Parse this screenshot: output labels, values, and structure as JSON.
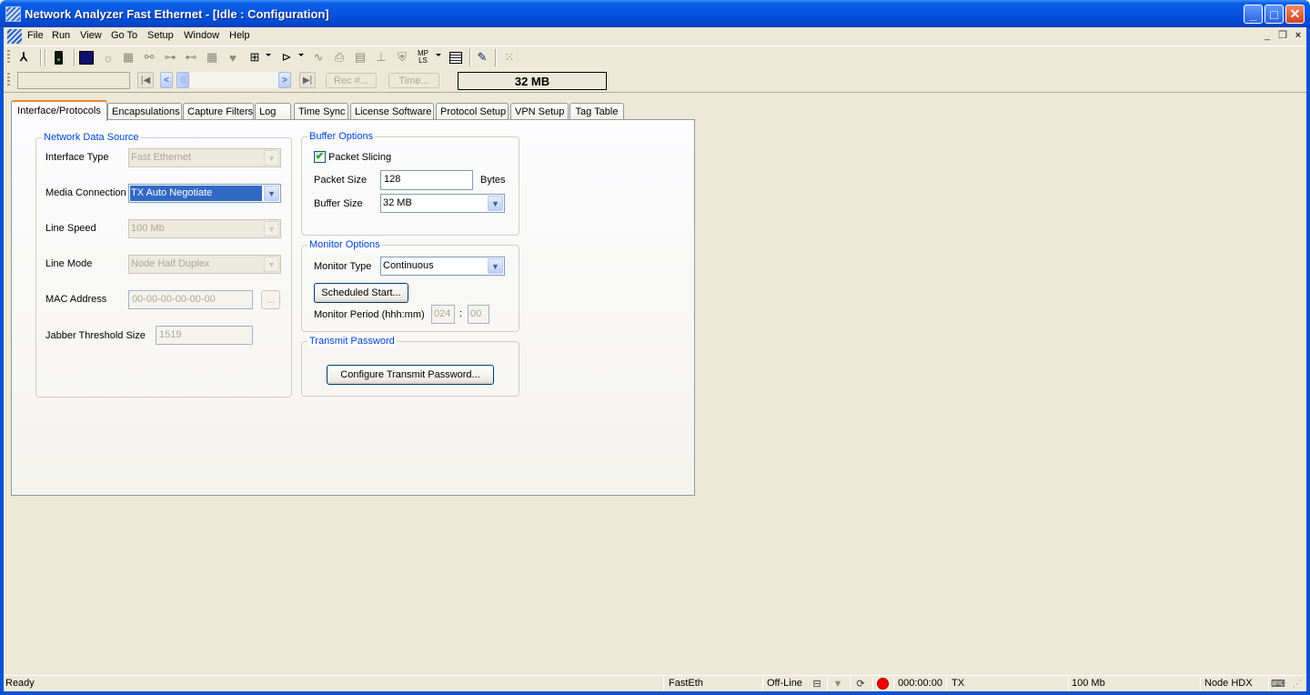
{
  "window": {
    "title": "Network Analyzer Fast Ethernet - [Idle : Configuration]",
    "controls": {
      "minimize": "_",
      "maximize": "□",
      "close": "✕"
    },
    "mdi_controls": {
      "minimize": "_",
      "restore": "❐",
      "close": "×"
    }
  },
  "menu": {
    "items": [
      "File",
      "Run",
      "View",
      "Go To",
      "Setup",
      "Window",
      "Help"
    ]
  },
  "toolbar": {
    "icons": [
      {
        "name": "run-icon",
        "glyph": "🏃"
      },
      {
        "name": "traffic-light-icon",
        "glyph": "▮"
      },
      {
        "name": "monitor-icon",
        "glyph": "◙"
      },
      {
        "name": "light-bulb-icon",
        "glyph": "☼"
      },
      {
        "name": "station-icon",
        "glyph": "▦"
      },
      {
        "name": "nodes-icon",
        "glyph": "⚯"
      },
      {
        "name": "network-map-icon",
        "glyph": "⊶"
      },
      {
        "name": "network-link-icon",
        "glyph": "⊷"
      },
      {
        "name": "grid-icon",
        "glyph": "▦"
      },
      {
        "name": "heart-icon",
        "glyph": "♥"
      },
      {
        "name": "protocol-icon",
        "glyph": "⊞"
      },
      {
        "name": "filter-icon",
        "glyph": "⊳"
      },
      {
        "name": "waveform-icon",
        "glyph": "∿"
      },
      {
        "name": "printer-icon",
        "glyph": "⎙"
      },
      {
        "name": "lmi-icon",
        "glyph": "▤"
      },
      {
        "name": "hierarchy-icon",
        "glyph": "⊥"
      },
      {
        "name": "shield-icon",
        "glyph": "⛨"
      },
      {
        "name": "mpls-icon",
        "glyph": "MP LS"
      },
      {
        "name": "table-icon",
        "glyph": "▤"
      },
      {
        "name": "wrench-icon",
        "glyph": "🔧"
      },
      {
        "name": "dotted-grid-icon",
        "glyph": "⁙"
      }
    ]
  },
  "navbar": {
    "first": "|◀",
    "prev": "<",
    "next": ">",
    "last": "▶|",
    "rec_button": "Rec #...",
    "time_button": "Time...",
    "buffer_display": "32 MB"
  },
  "tabs": [
    {
      "label": "Interface/Protocols",
      "active": true
    },
    {
      "label": "Encapsulations"
    },
    {
      "label": "Capture Filters"
    },
    {
      "label": "Log"
    },
    {
      "label": "Time Sync"
    },
    {
      "label": "License Software"
    },
    {
      "label": "Protocol Setup"
    },
    {
      "label": "VPN Setup"
    },
    {
      "label": "Tag Table"
    }
  ],
  "network_data_source": {
    "legend": "Network Data Source",
    "interface_type": {
      "label": "Interface Type",
      "value": "Fast Ethernet"
    },
    "media_connection": {
      "label": "Media Connection",
      "value": "TX Auto Negotiate"
    },
    "line_speed": {
      "label": "Line Speed",
      "value": "100 Mb"
    },
    "line_mode": {
      "label": "Line Mode",
      "value": "Node Half Duplex"
    },
    "mac_address": {
      "label": "MAC Address",
      "value": "00-00-00-00-00-00",
      "browse": "..."
    },
    "jabber_threshold": {
      "label": "Jabber Threshold Size",
      "value": "1519"
    }
  },
  "buffer_options": {
    "legend": "Buffer Options",
    "packet_slicing": {
      "label": "Packet Slicing",
      "checked": true,
      "mark": "✔"
    },
    "packet_size": {
      "label": "Packet Size",
      "value": "128",
      "unit": "Bytes"
    },
    "buffer_size": {
      "label": "Buffer Size",
      "value": "32 MB"
    }
  },
  "monitor_options": {
    "legend": "Monitor Options",
    "monitor_type": {
      "label": "Monitor Type",
      "value": "Continuous"
    },
    "scheduled_start": "Scheduled Start...",
    "monitor_period": {
      "label": "Monitor Period (hhh:mm)",
      "hours": "024",
      "sep": ":",
      "minutes": "00"
    }
  },
  "transmit_password": {
    "legend": "Transmit Password",
    "button": "Configure Transmit Password..."
  },
  "statusbar": {
    "status": "Ready",
    "interface": "FastEth",
    "mode": "Off-Line",
    "timer": "000:00:00",
    "tx": "TX",
    "speed": "100 Mb",
    "duplex": "Node HDX"
  },
  "colors": {
    "accent": "#316ac5",
    "legend": "#0046d5",
    "titlebar": "#0554e0",
    "record": "#e00000"
  }
}
